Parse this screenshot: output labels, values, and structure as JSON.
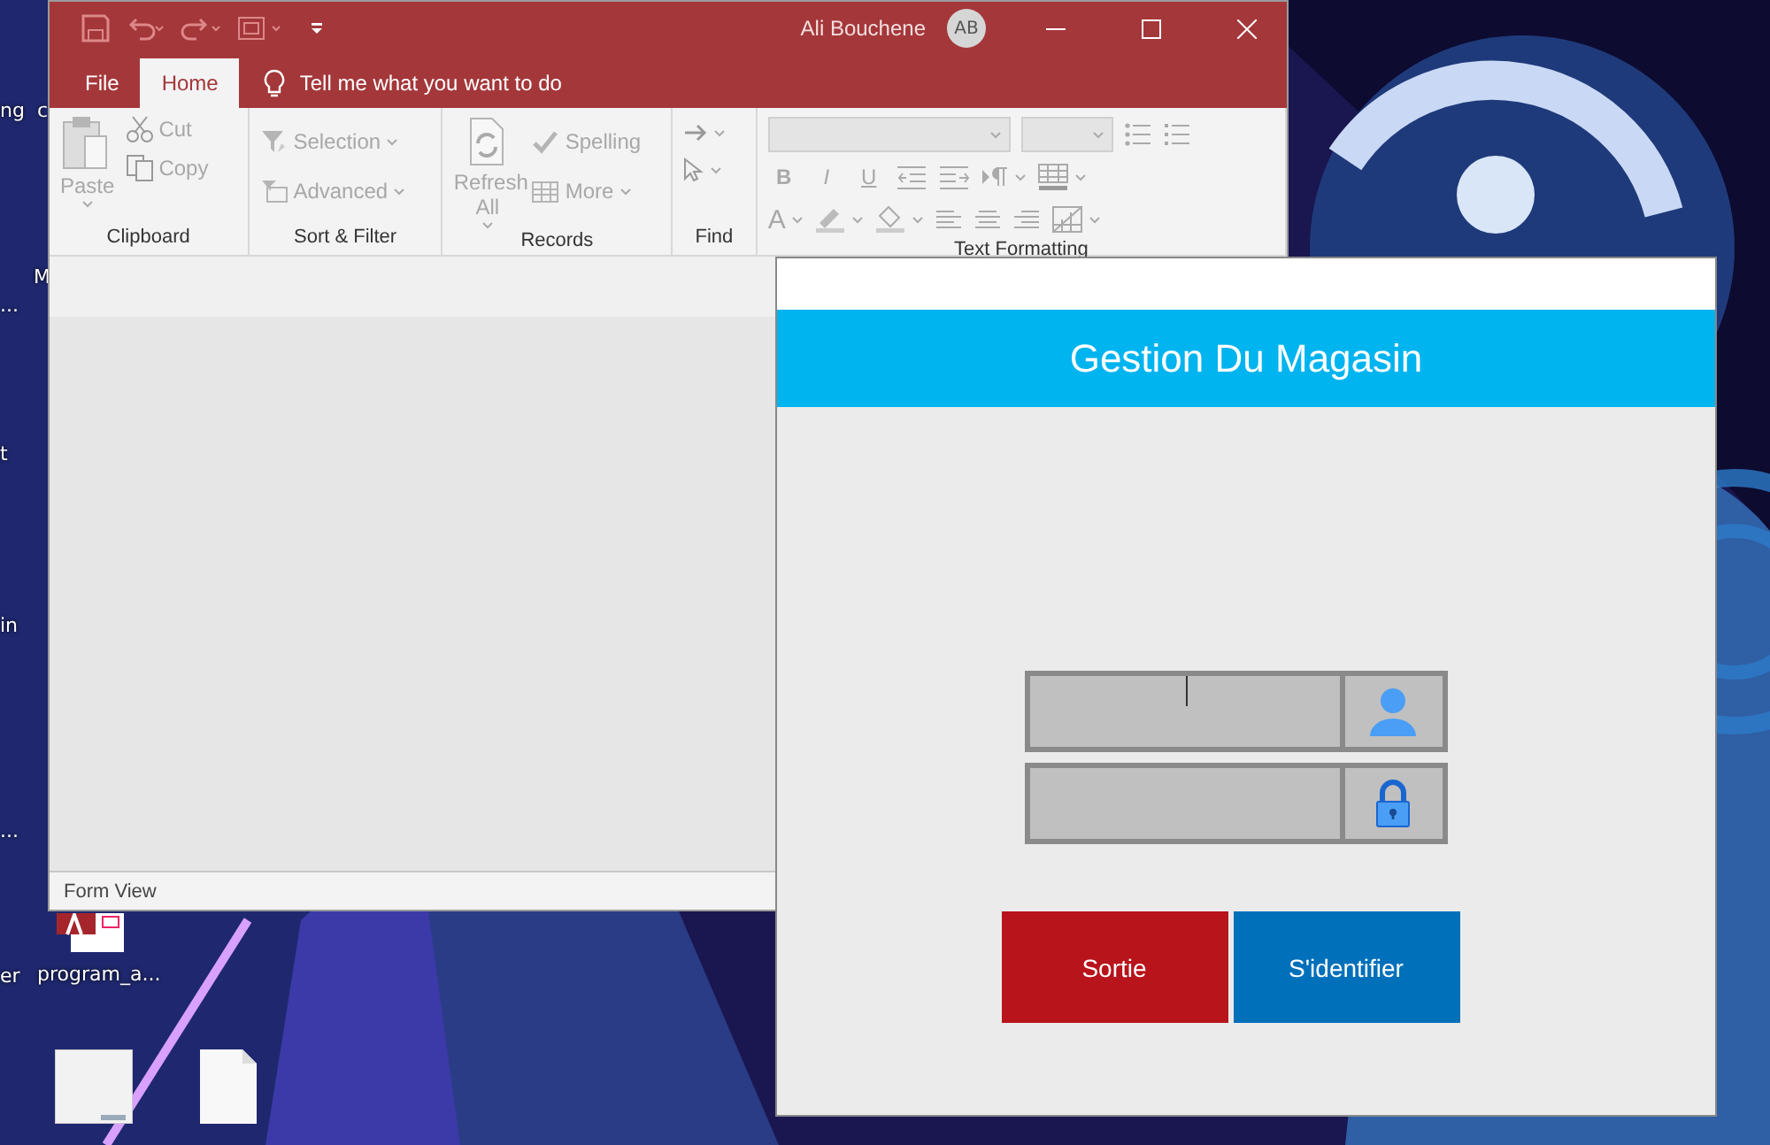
{
  "desktop": {
    "edge_labels": [
      "ng",
      "c",
      "M",
      "...",
      "t",
      "in",
      "...",
      "er"
    ],
    "icons": [
      {
        "kind": "access",
        "label": "program_a..."
      },
      {
        "kind": "sheet"
      },
      {
        "kind": "file"
      }
    ]
  },
  "access_window": {
    "user_name": "Ali Bouchene",
    "avatar_initials": "AB",
    "tabs": [
      {
        "label": "File",
        "selected": false
      },
      {
        "label": "Home",
        "selected": true
      }
    ],
    "tell_me": "Tell me what you want to do",
    "ribbon": {
      "groups": [
        {
          "label": "Clipboard",
          "items": [
            {
              "label": "Paste",
              "disabled": true
            },
            {
              "label": "Cut",
              "disabled": true
            },
            {
              "label": "Copy",
              "disabled": true
            }
          ]
        },
        {
          "label": "Sort & Filter",
          "items": [
            {
              "label": "Selection",
              "disabled": true
            },
            {
              "label": "Advanced",
              "disabled": true
            }
          ]
        },
        {
          "label": "Records",
          "items": [
            {
              "label": "Refresh All",
              "disabled": true
            },
            {
              "label": "Spelling",
              "disabled": true
            },
            {
              "label": "More",
              "disabled": true
            }
          ]
        },
        {
          "label": "Find"
        },
        {
          "label": "Text Formatting",
          "items": [
            {
              "label": "B",
              "disabled": true
            },
            {
              "label": "I",
              "disabled": true
            },
            {
              "label": "U",
              "disabled": true
            },
            {
              "label": "A",
              "disabled": true
            }
          ]
        }
      ]
    },
    "status_bar": "Form View"
  },
  "login_dialog": {
    "title": "Gestion Du Magasin",
    "fields": [
      {
        "kind": "user",
        "focused": true
      },
      {
        "kind": "lock",
        "focused": false
      }
    ],
    "buttons": [
      {
        "label": "Sortie",
        "color": "#b8141b"
      },
      {
        "label": "S'identifier",
        "color": "#0070ba"
      }
    ]
  }
}
